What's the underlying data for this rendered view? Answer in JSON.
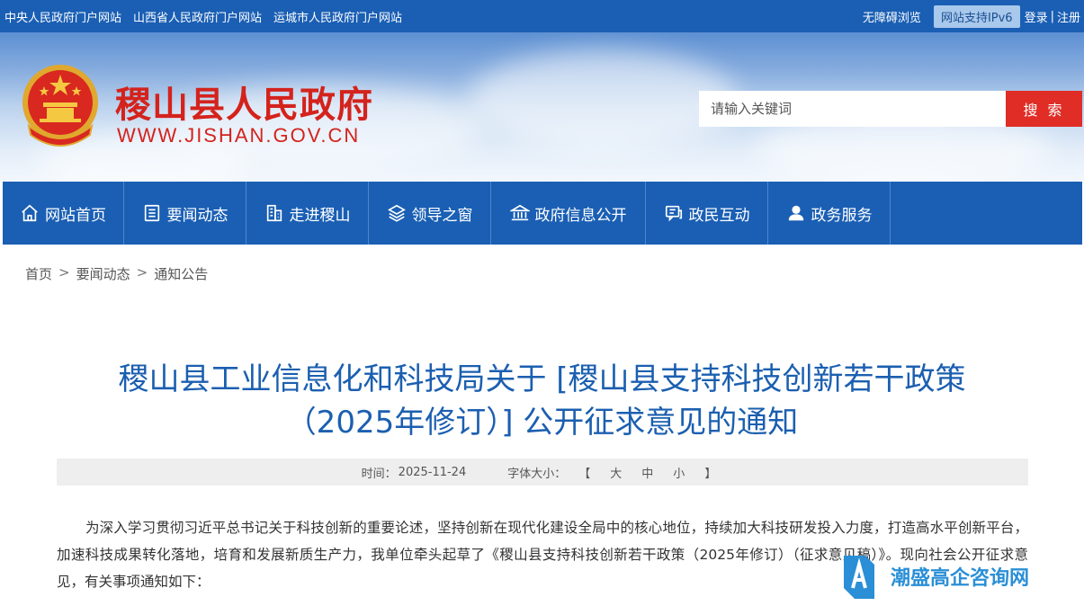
{
  "topbar": {
    "links": [
      "中央人民政府门户网站",
      "山西省人民政府门户网站",
      "运城市人民政府门户网站"
    ],
    "accessibility": "无障碍浏览",
    "ipv6": "网站支持IPv6",
    "login": "登录",
    "separator": "|",
    "register": "注册"
  },
  "header": {
    "title": "稷山县人民政府",
    "url": "WWW.JISHAN.GOV.CN",
    "search_placeholder": "请输入关键词",
    "search_button": "搜 索"
  },
  "nav": [
    {
      "label": "网站首页",
      "icon": "home-icon"
    },
    {
      "label": "要闻动态",
      "icon": "news-icon"
    },
    {
      "label": "走进稷山",
      "icon": "building-icon"
    },
    {
      "label": "领导之窗",
      "icon": "layers-icon"
    },
    {
      "label": "政府信息公开",
      "icon": "institution-icon"
    },
    {
      "label": "政民互动",
      "icon": "chat-icon"
    },
    {
      "label": "政务服务",
      "icon": "user-icon"
    }
  ],
  "breadcrumb": {
    "items": [
      "首页",
      "要闻动态",
      "通知公告"
    ],
    "separator": ">"
  },
  "article": {
    "title_line1": "稷山县工业信息化和科技局关于 [稷山县支持科技创新若干政策",
    "title_line2": "（2025年修订）] 公开征求意见的通知",
    "time_label": "时间：",
    "time_value": "2025-11-24",
    "font_size_label": "字体大小：",
    "font_bracket_open": "【",
    "font_large": "大",
    "font_medium": "中",
    "font_small": "小",
    "font_bracket_close": "】",
    "paragraph": "为深入学习贯彻习近平总书记关于科技创新的重要论述，坚持创新在现代化建设全局中的核心地位，持续加大科技研发投入力度，打造高水平创新平台，加速科技成果转化落地，培育和发展新质生产力，我单位牵头起草了《稷山县支持科技创新若干政策（2025年修订）（征求意见稿）》。现向社会公开征求意见，有关事项通知如下："
  },
  "watermark": {
    "text": "潮盛高企咨询网"
  },
  "colors": {
    "primary_blue": "#1a5fb4",
    "title_red": "#d4231c",
    "search_red": "#e02d25",
    "article_title_blue": "#1b5fb0"
  }
}
